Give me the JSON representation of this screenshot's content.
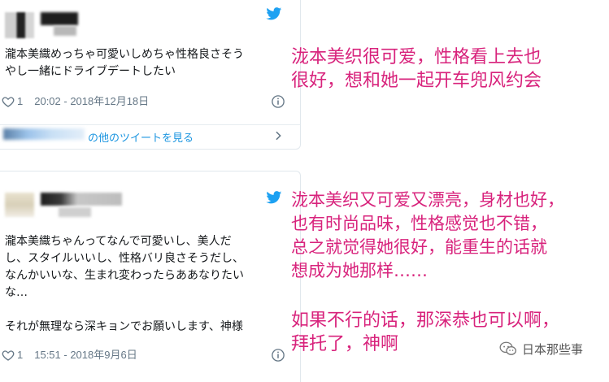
{
  "tweet1": {
    "text": "瀧本美織めっちゃ可愛いしめちゃ性格良さそう\nやし一緒にドライブデートしたい",
    "likes": "1",
    "timestamp": "20:02 - 2018年12月18日",
    "see_more": "の他のツイートを見る"
  },
  "tweet2": {
    "text": "瀧本美織ちゃんってなんで可愛いし、美人だ\nし、スタイルいいし、性格バリ良さそうだし、\nなんかいいな、生まれ変わったらああなりたい\nな…\n\nそれが無理なら深キョンでお願いします、神様",
    "likes": "1",
    "timestamp": "15:51 - 2018年9月6日"
  },
  "annotations": {
    "a1": "泷本美织很可爱，性格看上去也\n很好，想和她一起开车兜风约会",
    "a2": "泷本美织又可爱又漂亮，身材也好，\n也有时尚品味，性格感觉也不错，\n总之就觉得她很好，能重生的话就\n想成为她那样……",
    "a3": "如果不行的话，那深恭也可以啊，\n拜托了，神啊"
  },
  "watermark": {
    "label": "日本那些事"
  },
  "colors": {
    "twitter_blue": "#1da1f2",
    "annotation_pink": "#d8237c",
    "meta_gray": "#657786"
  },
  "icons": [
    "twitter-bird-icon",
    "heart-icon",
    "info-icon",
    "chevron-right-icon",
    "wechat-icon"
  ]
}
